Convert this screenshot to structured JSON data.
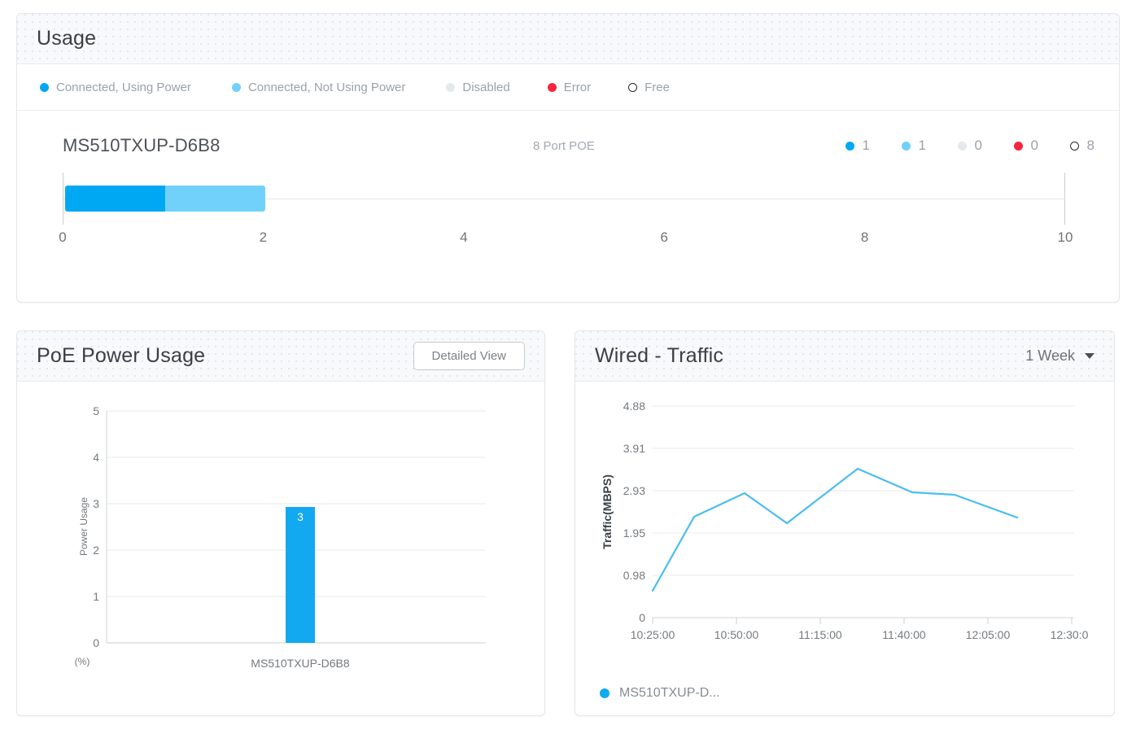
{
  "usage": {
    "title": "Usage",
    "legend": [
      {
        "label": "Connected, Using Power",
        "color": "#00a8f3",
        "style": "solid"
      },
      {
        "label": "Connected, Not Using Power",
        "color": "#71d1fb",
        "style": "solid"
      },
      {
        "label": "Disabled",
        "color": "#e6e9ec",
        "style": "solid"
      },
      {
        "label": "Error",
        "color": "#f5263f",
        "style": "solid"
      },
      {
        "label": "Free",
        "color": "#ffffff",
        "style": "hollow"
      }
    ],
    "device": {
      "name": "MS510TXUP-D6B8",
      "type": "8 Port POE",
      "counts": [
        {
          "value": "1",
          "color": "#00a8f3",
          "style": "solid",
          "state": "connected-using-power"
        },
        {
          "value": "1",
          "color": "#71d1fb",
          "style": "solid",
          "state": "connected-not-using-power"
        },
        {
          "value": "0",
          "color": "#e6e9ec",
          "style": "solid",
          "state": "disabled"
        },
        {
          "value": "0",
          "color": "#f5263f",
          "style": "solid",
          "state": "error"
        },
        {
          "value": "8",
          "color": "#ffffff",
          "style": "hollow",
          "state": "free"
        }
      ],
      "segments": [
        {
          "state": "connected-using-power",
          "value": 1,
          "color": "#00a8f3"
        },
        {
          "state": "connected-not-using-power",
          "value": 1,
          "color": "#71d1fb"
        }
      ]
    },
    "axis": {
      "min": 0,
      "max": 10,
      "ticks": [
        "0",
        "2",
        "4",
        "6",
        "8",
        "10"
      ]
    }
  },
  "poe": {
    "title": "PoE Power Usage",
    "detailed_view_label": "Detailed View",
    "unit_label": "(%)"
  },
  "wired": {
    "title": "Wired - Traffic",
    "period": "1 Week",
    "legend_label": "MS510TXUP-D..."
  },
  "chart_data": [
    {
      "type": "bar",
      "title": "PoE Power Usage",
      "categories": [
        "MS510TXUP-D6B8"
      ],
      "values": [
        2.93
      ],
      "data_labels": [
        "3"
      ],
      "xlabel": "",
      "ylabel": "Power Usage",
      "unit": "(%)",
      "ylim": [
        0,
        5
      ],
      "yticks": [
        "0",
        "1",
        "2",
        "3",
        "4",
        "5"
      ],
      "grid": true,
      "legend": "none",
      "color": "#12a9f0"
    },
    {
      "type": "line",
      "title": "Wired - Traffic",
      "period": "1 Week",
      "xlabel": "",
      "ylabel": "Traffic(MBPS)",
      "ylim": [
        0,
        4.88
      ],
      "yticks": [
        "0",
        "0.98",
        "1.95",
        "2.93",
        "3.91",
        "4.88"
      ],
      "x": [
        "10:25:00",
        "10:50:00",
        "11:15:00",
        "11:40:00",
        "12:05:00",
        "12:30:0"
      ],
      "grid": true,
      "legend_position": "bottom-left",
      "series": [
        {
          "name": "MS510TXUP-D...",
          "color": "#49bdf0",
          "points": [
            {
              "x": 0.0,
              "y": 0.62
            },
            {
              "x": 0.5,
              "y": 2.32
            },
            {
              "x": 1.1,
              "y": 2.87
            },
            {
              "x": 1.6,
              "y": 2.17
            },
            {
              "x": 2.45,
              "y": 3.44
            },
            {
              "x": 3.1,
              "y": 2.88
            },
            {
              "x": 3.6,
              "y": 2.84
            },
            {
              "x": 4.35,
              "y": 2.31
            }
          ]
        }
      ]
    }
  ]
}
